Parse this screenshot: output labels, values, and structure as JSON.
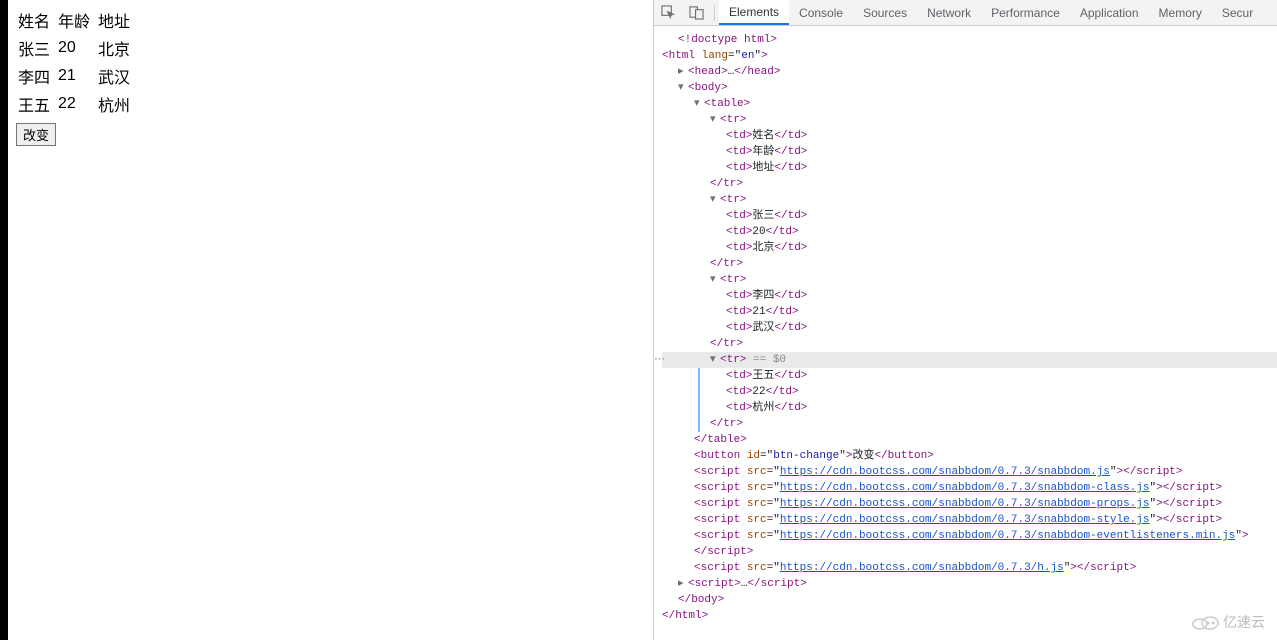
{
  "page": {
    "table": {
      "headers": [
        "姓名",
        "年龄",
        "地址"
      ],
      "rows": [
        {
          "name": "张三",
          "age": "20",
          "addr": "北京"
        },
        {
          "name": "李四",
          "age": "21",
          "addr": "武汉"
        },
        {
          "name": "王五",
          "age": "22",
          "addr": "杭州"
        }
      ]
    },
    "change_button": "改变"
  },
  "devtools": {
    "tabs": [
      "Elements",
      "Console",
      "Sources",
      "Network",
      "Performance",
      "Application",
      "Memory",
      "Secur"
    ],
    "active_tab": "Elements",
    "dom": {
      "doctype": "<!doctype html>",
      "html_open": {
        "tag": "html",
        "attrs": [
          [
            "lang",
            "en"
          ]
        ]
      },
      "head_collapsed": "<head>…</head>",
      "body_open": "body",
      "table_open": "table",
      "tr_header": {
        "cells": [
          "姓名",
          "年龄",
          "地址"
        ]
      },
      "tr_rows": [
        {
          "cells": [
            "张三",
            "20",
            "北京"
          ]
        },
        {
          "cells": [
            "李四",
            "21",
            "武汉"
          ]
        },
        {
          "cells": [
            "王五",
            "22",
            "杭州"
          ],
          "selected": true
        }
      ],
      "selected_marker": "== $0",
      "button": {
        "id": "btn-change",
        "text": "改变"
      },
      "scripts": [
        "https://cdn.bootcss.com/snabbdom/0.7.3/snabbdom.js",
        "https://cdn.bootcss.com/snabbdom/0.7.3/snabbdom-class.js",
        "https://cdn.bootcss.com/snabbdom/0.7.3/snabbdom-props.js",
        "https://cdn.bootcss.com/snabbdom/0.7.3/snabbdom-style.js",
        "https://cdn.bootcss.com/snabbdom/0.7.3/snabbdom-eventlisteners.min.js",
        "https://cdn.bootcss.com/snabbdom/0.7.3/h.js"
      ],
      "script_collapsed": "<script>…</﻿script>",
      "body_close": "</body>",
      "html_close": "</html>"
    }
  },
  "watermark": "亿速云"
}
